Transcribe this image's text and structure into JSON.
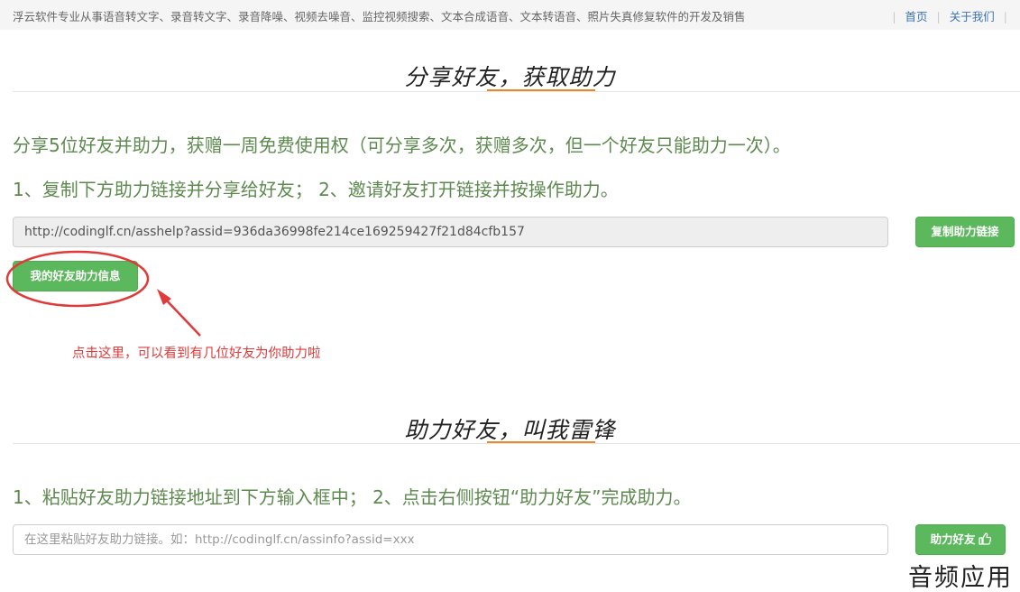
{
  "topbar": {
    "tagline": "浮云软件专业从事语音转文字、录音转文字、录音降噪、视频去噪音、监控视频搜索、文本合成语音、文本转语音、照片失真修复软件的开发及销售",
    "nav": {
      "home": "首页",
      "about": "关于我们"
    }
  },
  "section_share": {
    "title": "分享好友，获取助力",
    "intro": "分享5位好友并助力，获赠一周免费使用权（可分享多次，获赠多次，但一个好友只能助力一次）。",
    "steps": "1、复制下方助力链接并分享给好友；  2、邀请好友打开链接并按操作助力。",
    "link": "http://codinglf.cn/asshelp?assid=936da36998fe214ce169259427f21d84cfb157",
    "copy_button": "复制助力链接",
    "my_info_button": "我的好友助力信息",
    "annotation": "点击这里，可以看到有几位好友为你助力啦"
  },
  "section_help": {
    "title": "助力好友，叫我雷锋",
    "steps": "1、粘贴好友助力链接地址到下方输入框中；  2、点击右侧按钮“助力好友”完成助力。",
    "input_placeholder": "在这里粘贴好友助力链接。如：http://codinglf.cn/assinfo?assid=xxx",
    "input_value": "",
    "help_button": "助力好友",
    "help_button_icon": "thumbs-up-icon"
  },
  "watermark": "音频应用",
  "colors": {
    "accent_underline": "#e8872f",
    "green_button": "#5cb85c",
    "green_text": "#5d8a4e",
    "annotation_red": "#e03a3a",
    "link_blue": "#3a73b8"
  }
}
